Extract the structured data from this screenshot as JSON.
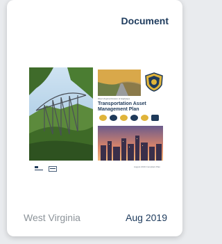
{
  "card": {
    "doc_type_label": "Document",
    "state": "West Virginia",
    "date": "Aug 2019"
  },
  "cover": {
    "agency_line": "West Virginia Division of Highways",
    "plan_title": "Transportation Asset Management Plan",
    "cover_date": "August 2019 Compliant Plan",
    "icons": [
      "bridge-icon",
      "culvert-icon",
      "pavement-icon",
      "wall-icon",
      "sign-icon",
      "document-icon"
    ]
  },
  "colors": {
    "title_blue": "#1d3a5c",
    "muted_gray": "#8c9399",
    "plan_title_blue": "#1f3a5a"
  }
}
